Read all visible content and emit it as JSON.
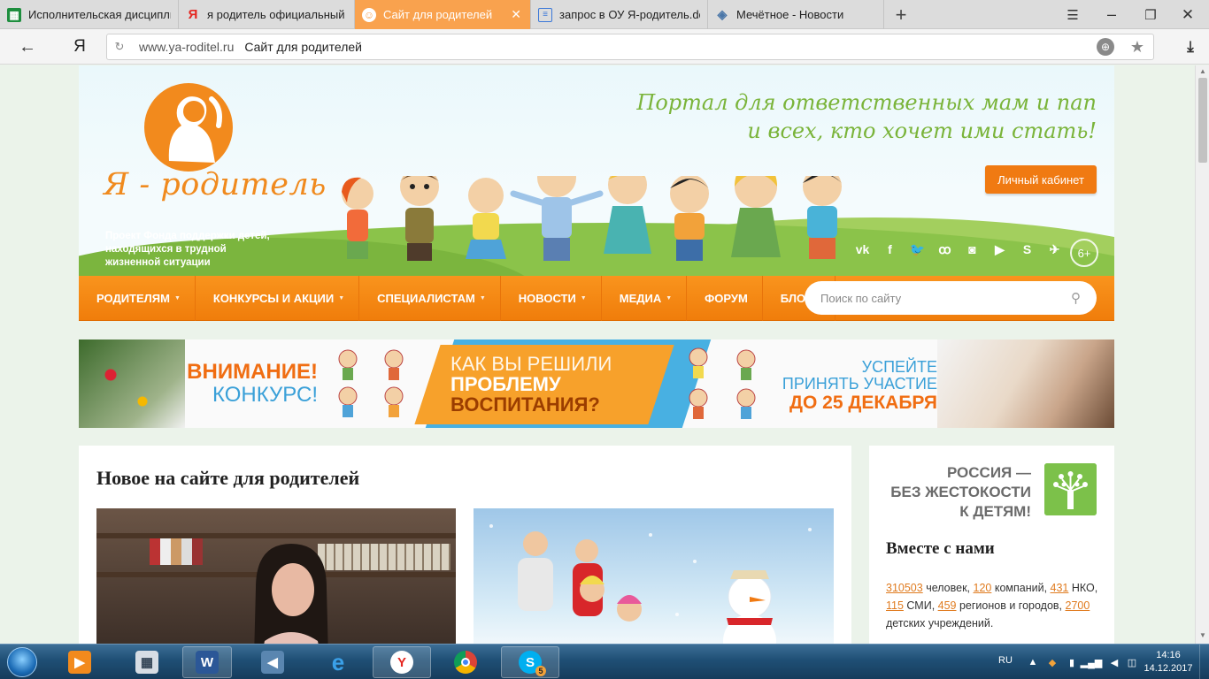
{
  "browser": {
    "tabs": [
      {
        "label": "Исполнительская дисципли",
        "icon": "sheets-icon",
        "color": "#1e8e3e"
      },
      {
        "label": "я родитель официальный с",
        "icon": "yandex-icon",
        "color": "#e52620"
      },
      {
        "label": "Сайт для родителей",
        "icon": "site-icon",
        "color": "#f9a24e"
      },
      {
        "label": "запрос в ОУ Я-родитель.do",
        "icon": "document-icon",
        "color": "#3b78d8"
      },
      {
        "label": "Мечётное - Новости",
        "icon": "vk-icon",
        "color": "#4a76a8"
      }
    ],
    "url_domain": "www.ya-roditel.ru",
    "url_title": "Сайт для родителей",
    "ya_label": "Я"
  },
  "site": {
    "logo_text": "Я - родитель",
    "project_text": "Проект Фонда поддержки детей, находящихся в трудной жизненной ситуации",
    "tagline_1": "Портал для ответственных мам и пап",
    "tagline_2": "и всех, кто хочет ими стать!",
    "cabinet_label": "Личный кабинет",
    "social": [
      "vk",
      "f",
      "twitter",
      "ok",
      "instagram",
      "youtube",
      "skype",
      "telegram"
    ],
    "age_rating": "6+",
    "nav": [
      {
        "label": "РОДИТЕЛЯМ",
        "has_caret": true
      },
      {
        "label": "КОНКУРСЫ И АКЦИИ",
        "has_caret": true
      },
      {
        "label": "СПЕЦИАЛИСТАМ",
        "has_caret": true
      },
      {
        "label": "НОВОСТИ",
        "has_caret": true
      },
      {
        "label": "МЕДИА",
        "has_caret": true
      },
      {
        "label": "ФОРУМ",
        "has_caret": false
      },
      {
        "label": "БЛОГИ",
        "has_caret": false
      }
    ],
    "search_placeholder": "Поиск по сайту",
    "banner": {
      "attention_1": "ВНИМАНИЕ!",
      "attention_2": "КОНКУРС!",
      "question_1": "КАК ВЫ РЕШИЛИ",
      "question_2": "ПРОБЛЕМУ",
      "question_3": "ВОСПИТАНИЯ?",
      "deadline_1": "УСПЕЙТЕ",
      "deadline_2": "ПРИНЯТЬ УЧАСТИЕ",
      "deadline_3": "ДО 25 ДЕКАБРЯ"
    },
    "main_title": "Новое на сайте для родителей",
    "sidebar": {
      "russia_1": "РОССИЯ —",
      "russia_2": "БЕЗ ЖЕСТОКОСТИ",
      "russia_3": "К ДЕТЯМ!",
      "together_title": "Вместе с нами",
      "stats": {
        "people": "310503",
        "people_label": " человек, ",
        "companies": "120",
        "companies_label": " компаний, ",
        "nko": "431",
        "nko_label": " НКО, ",
        "media": "115",
        "media_label": " СМИ, ",
        "regions": "459",
        "regions_label": " регионов и городов, ",
        "institutions": "2700",
        "institutions_label": " детских учреждений."
      }
    }
  },
  "taskbar": {
    "apps": [
      "media-player",
      "calculator",
      "word",
      "volume",
      "internet-explorer",
      "yandex-browser",
      "chrome",
      "skype"
    ],
    "skype_badge": "5",
    "lang": "RU",
    "time": "14:16",
    "date": "14.12.2017"
  },
  "colors": {
    "accent_orange": "#f07d0b",
    "tagline_green": "#7ab43a",
    "link_orange": "#e07b1f",
    "active_tab": "#f9a24e"
  }
}
